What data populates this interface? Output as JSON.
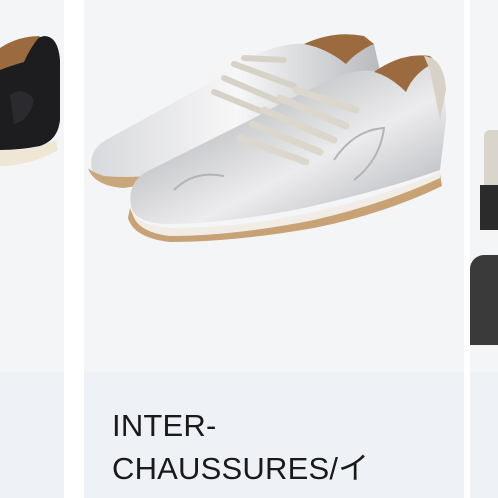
{
  "products": [
    {
      "brand": "",
      "image_alt": "black leather sneaker"
    },
    {
      "brand": "INTER-\nCHAUSSURES/イ",
      "image_alt": "silver metallic leather sneakers"
    },
    {
      "brand": "",
      "image_alt": "partially visible shoe"
    }
  ],
  "colors": {
    "card_bg": "#f3f4f6",
    "info_bg": "#eef1f5",
    "text": "#1a1a1a"
  }
}
